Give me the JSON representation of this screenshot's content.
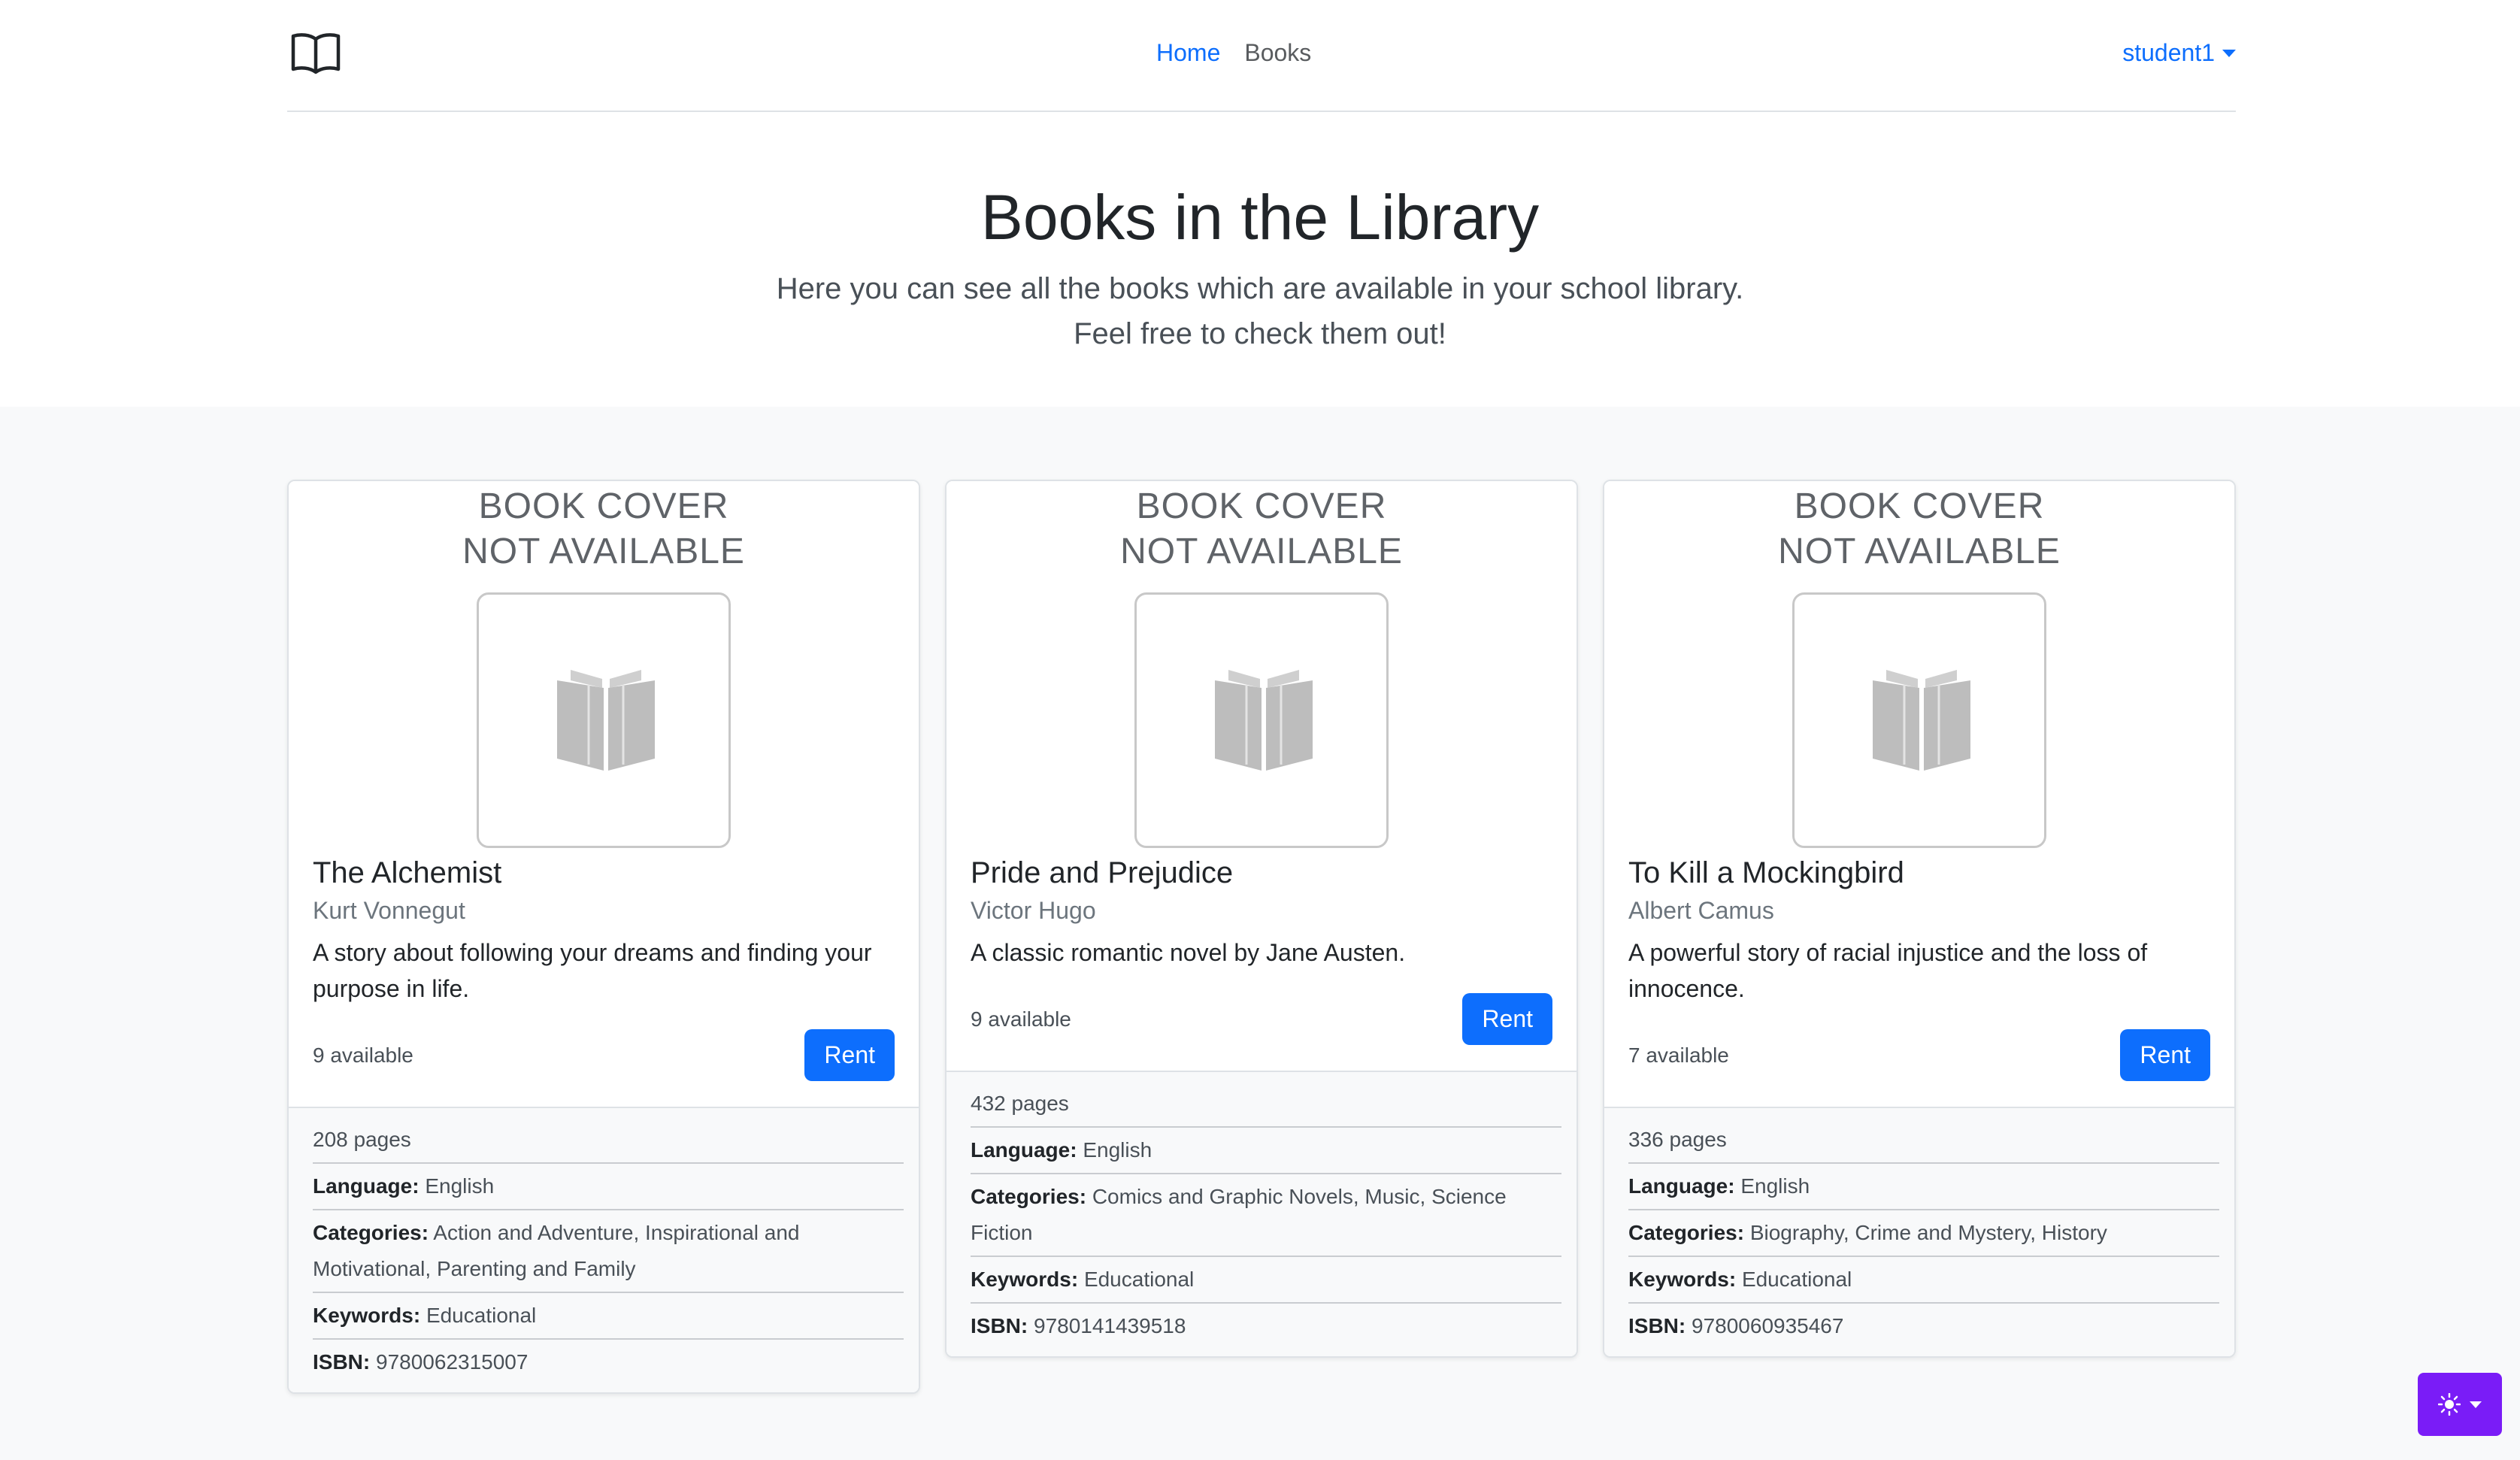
{
  "nav": {
    "brand_icon": "open-book-icon",
    "home": "Home",
    "books": "Books",
    "user": "student1"
  },
  "hero": {
    "title": "Books in the Library",
    "lead_line1": "Here you can see all the books which are available in your school library.",
    "lead_line2": "Feel free to check them out!"
  },
  "cover_placeholder": {
    "line1": "BOOK COVER",
    "line2": "NOT AVAILABLE"
  },
  "books": [
    {
      "title": "The Alchemist",
      "author": "Kurt Vonnegut",
      "description": "A story about following your dreams and finding your purpose in life.",
      "available": "9 available",
      "rent_label": "Rent",
      "pages": "208 pages",
      "language_label": "Language:",
      "language": "English",
      "categories_label": "Categories:",
      "categories": "Action and Adventure, Inspirational and Motivational, Parenting and Family",
      "keywords_label": "Keywords:",
      "keywords": "Educational",
      "isbn_label": "ISBN:",
      "isbn": "9780062315007"
    },
    {
      "title": "Pride and Prejudice",
      "author": "Victor Hugo",
      "description": "A classic romantic novel by Jane Austen.",
      "available": "9 available",
      "rent_label": "Rent",
      "pages": "432 pages",
      "language_label": "Language:",
      "language": "English",
      "categories_label": "Categories:",
      "categories": "Comics and Graphic Novels, Music, Science Fiction",
      "keywords_label": "Keywords:",
      "keywords": "Educational",
      "isbn_label": "ISBN:",
      "isbn": "9780141439518"
    },
    {
      "title": "To Kill a Mockingbird",
      "author": "Albert Camus",
      "description": "A powerful story of racial injustice and the loss of innocence.",
      "available": "7 available",
      "rent_label": "Rent",
      "pages": "336 pages",
      "language_label": "Language:",
      "language": "English",
      "categories_label": "Categories:",
      "categories": "Biography, Crime and Mystery, History",
      "keywords_label": "Keywords:",
      "keywords": "Educational",
      "isbn_label": "ISBN:",
      "isbn": "9780060935467"
    }
  ],
  "theme_toggle": {
    "icon": "sun-icon"
  },
  "colors": {
    "primary": "#0d6efd",
    "theme_button": "#7a1cf7",
    "album_bg": "#f8f9fa"
  }
}
